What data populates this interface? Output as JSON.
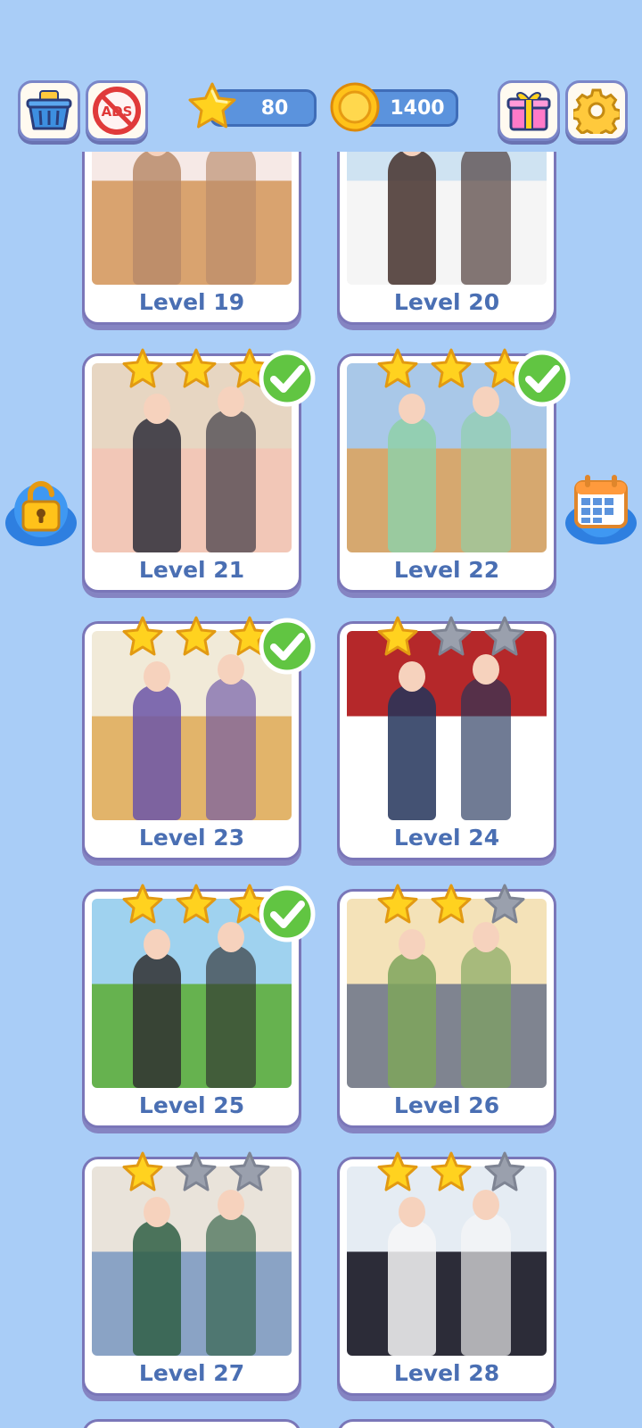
{
  "header": {
    "stars": "80",
    "coins": "1400",
    "ads_label": "ADS"
  },
  "levels": [
    {
      "label": "Level 19",
      "stars": 0,
      "done": false,
      "palette": [
        "#f6e9e6",
        "#d9a36f",
        "#b88b6a"
      ]
    },
    {
      "label": "Level 20",
      "stars": 0,
      "done": false,
      "palette": [
        "#cfe3f2",
        "#f5f5f5",
        "#44302c"
      ]
    },
    {
      "label": "Level 21",
      "stars": 3,
      "done": true,
      "palette": [
        "#e7d6c2",
        "#f2c7b7",
        "#2e2e3a"
      ]
    },
    {
      "label": "Level 22",
      "stars": 3,
      "done": true,
      "palette": [
        "#a9c8e8",
        "#d6a86f",
        "#8fd0a8"
      ]
    },
    {
      "label": "Level 23",
      "stars": 3,
      "done": true,
      "palette": [
        "#f1ead8",
        "#e2b46a",
        "#6b55a8"
      ]
    },
    {
      "label": "Level 24",
      "stars": 1,
      "done": false,
      "palette": [
        "#b5282a",
        "#ffffff",
        "#23345b"
      ]
    },
    {
      "label": "Level 25",
      "stars": 3,
      "done": true,
      "palette": [
        "#9fd2ef",
        "#66b24f",
        "#303030"
      ]
    },
    {
      "label": "Level 26",
      "stars": 2,
      "done": false,
      "palette": [
        "#f4e2b8",
        "#7f8490",
        "#7ea55c"
      ]
    },
    {
      "label": "Level 27",
      "stars": 1,
      "done": false,
      "palette": [
        "#e9e3da",
        "#8aa3c5",
        "#2f5f44"
      ]
    },
    {
      "label": "Level 28",
      "stars": 2,
      "done": false,
      "palette": [
        "#e5ecf3",
        "#2c2c38",
        "#f7f7f7"
      ]
    }
  ],
  "colors": {
    "background": "#a9cdf7",
    "card_border": "#7a76b8",
    "level_text": "#4a6fb3",
    "star_gold": "#ffd21f",
    "star_gray": "#9aa0ad",
    "check_green": "#61c542"
  },
  "icons": [
    "basket-icon",
    "no-ads-icon",
    "star-icon",
    "coin-icon",
    "gift-icon",
    "gear-icon",
    "unlock-icon",
    "calendar-icon",
    "check-icon"
  ]
}
